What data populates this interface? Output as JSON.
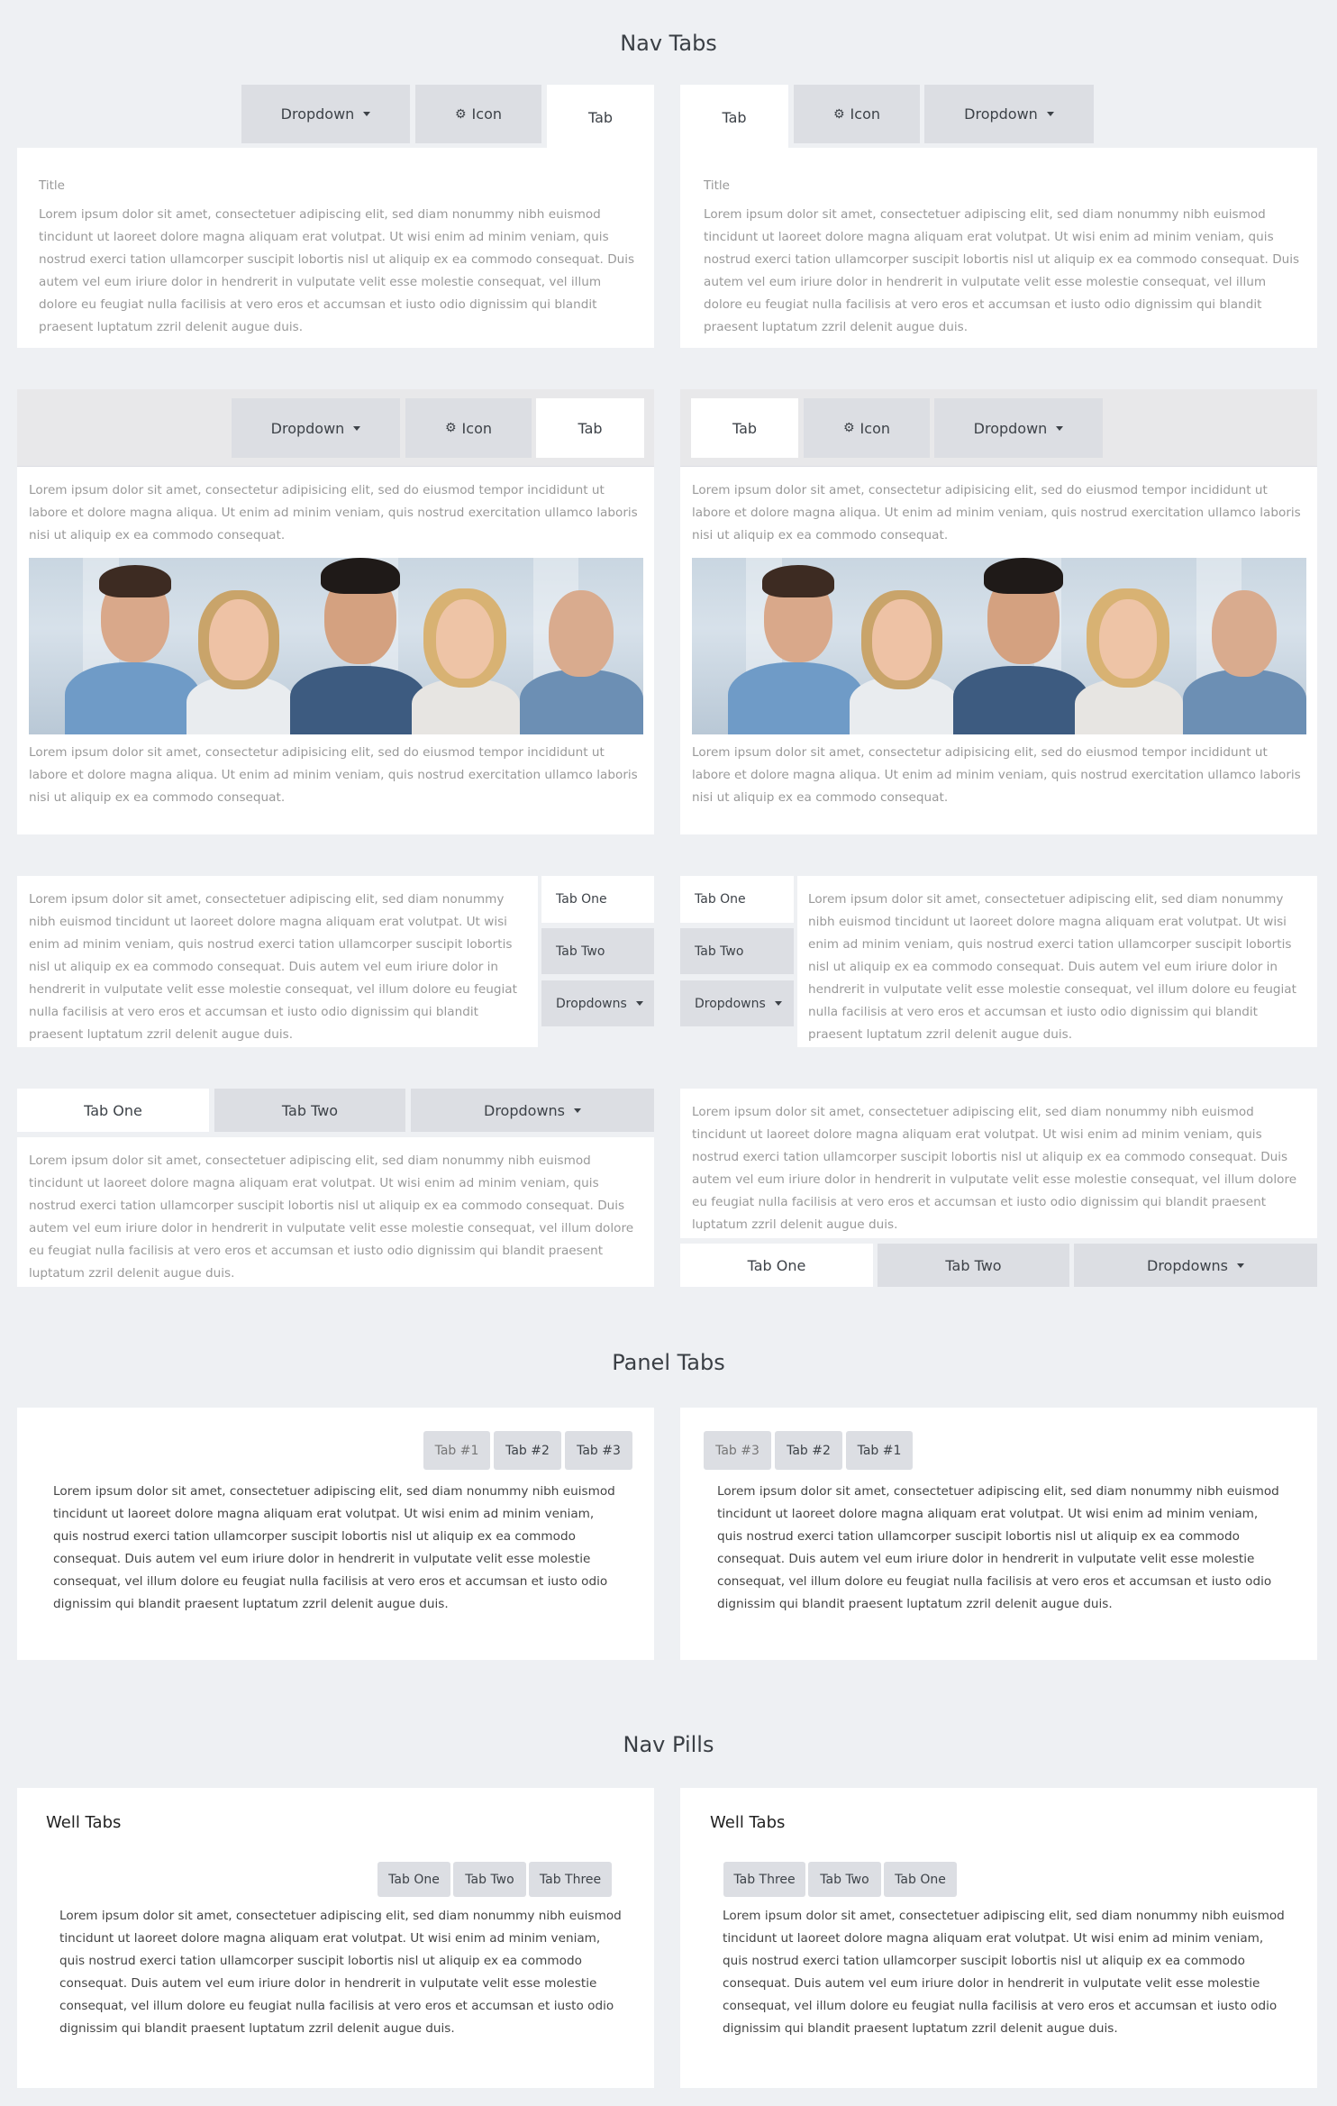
{
  "sections": {
    "nav_tabs": "Nav Tabs",
    "panel_tabs": "Panel Tabs",
    "nav_pills": "Nav Pills"
  },
  "labels": {
    "dropdown": "Dropdown",
    "icon": "Icon",
    "tab": "Tab",
    "title": "Title",
    "tab_one": "Tab One",
    "tab_two": "Tab Two",
    "tab_three": "Tab Three",
    "dropdowns": "Dropdowns",
    "tab_1": "Tab #1",
    "tab_2": "Tab #2",
    "tab_3": "Tab #3",
    "well_tabs": "Well Tabs"
  },
  "text": {
    "lorem_long": "Lorem ipsum dolor sit amet, consectetuer adipiscing elit, sed diam nonummy nibh euismod tincidunt ut laoreet dolore magna aliquam erat volutpat. Ut wisi enim ad minim veniam, quis nostrud exerci tation ullamcorper suscipit lobortis nisl ut aliquip ex ea commodo consequat. Duis autem vel eum iriure dolor in hendrerit in vulputate velit esse molestie consequat, vel illum dolore eu feugiat nulla facilisis at vero eros et accumsan et iusto odio dignissim qui blandit praesent luptatum zzril delenit augue duis.",
    "lorem_short": "Lorem ipsum dolor sit amet, consectetur adipisicing elit, sed do eiusmod tempor incididunt ut labore et dolore magna aliqua. Ut enim ad minim veniam, quis nostrud exercitation ullamco laboris nisi ut aliquip ex ea commodo consequat.",
    "lorem_panel": "Lorem ipsum dolor sit amet, consectetuer adipiscing elit, sed diam nonummy nibh euismod tincidunt ut laoreet dolore magna aliquam erat volutpat. Ut wisi enim ad minim veniam, quis nostrud exerci tation ullamcorper suscipit lobortis nisl ut aliquip ex ea commodo consequat. Duis autem vel eum iriure dolor in hendrerit in vulputate velit esse molestie consequat, vel illum dolore eu feugiat nulla facilisis at vero eros et accumsan et iusto odio dignissim qui blandit praesent luptatum zzril delenit augue duis."
  },
  "icons": {
    "gear": "gear-icon",
    "caret": "caret-down-icon"
  },
  "colors": {
    "page_bg": "#eef0f3",
    "tab_inactive": "#dcdee3",
    "tab_active": "#ffffff",
    "muted_text": "#999999"
  }
}
